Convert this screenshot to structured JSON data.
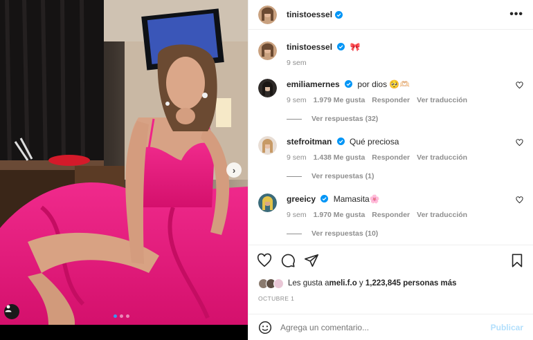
{
  "post": {
    "author": "tinistoessel",
    "caption_emoji": "🎀",
    "caption_time": "9 sem"
  },
  "header": {
    "username": "tinistoessel",
    "more_label": "•••"
  },
  "comments": [
    {
      "username": "emiliamernes",
      "text": "por dios 🥺🫶🏻",
      "time": "9 sem",
      "likes": "1.979 Me gusta",
      "reply_label": "Responder",
      "translate_label": "Ver traducción",
      "replies_label": "Ver respuestas (32)"
    },
    {
      "username": "stefroitman",
      "text": "Qué preciosa",
      "time": "9 sem",
      "likes": "1.438 Me gusta",
      "reply_label": "Responder",
      "translate_label": "Ver traducción",
      "replies_label": "Ver respuestas (1)"
    },
    {
      "username": "greeicy",
      "text": "Mamasita🌸",
      "time": "9 sem",
      "likes": "1.970 Me gusta",
      "reply_label": "Responder",
      "translate_label": "Ver traducción",
      "replies_label": "Ver respuestas (10)"
    }
  ],
  "likes": {
    "prefix": "Les gusta a ",
    "user": "meli.f.o",
    "joiner": " y ",
    "count": "1,223,845 personas más"
  },
  "date": "OCTUBRE 1",
  "add_comment": {
    "placeholder": "Agrega un comentario...",
    "publish_label": "Publicar"
  },
  "carousel": {
    "next_icon": "chevron-right-icon",
    "slide_count": 3,
    "active_slide": 1
  },
  "colors": {
    "accent_blue": "#3897f0",
    "verified_blue": "#0095f6",
    "dress_pink": "#e8197a",
    "publish_disabled": "#b2dffc"
  }
}
